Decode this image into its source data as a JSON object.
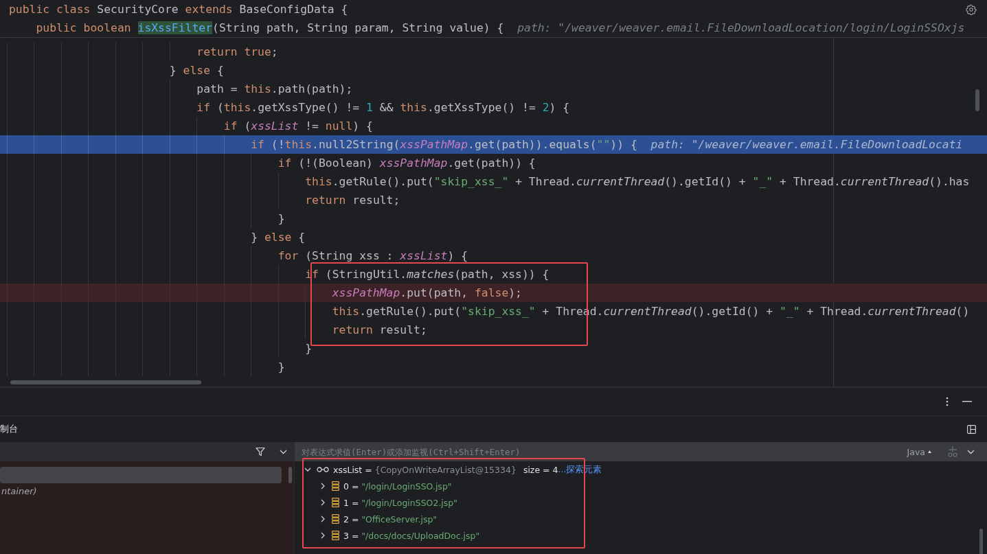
{
  "editor": {
    "sticky_lines": [
      {
        "tokens": [
          {
            "kind": "kw",
            "text": "public"
          },
          {
            "kind": "kw",
            "text": " class"
          },
          {
            "kind": "text",
            "text": " SecurityCore "
          },
          {
            "kind": "kw",
            "text": "extends"
          },
          {
            "kind": "text",
            "text": " BaseConfigData {"
          }
        ]
      },
      {
        "tokens": [
          {
            "kind": "kw",
            "text": "    public"
          },
          {
            "kind": "kw",
            "text": " boolean "
          },
          {
            "kind": "decl",
            "text": "isXssFilter"
          },
          {
            "kind": "text",
            "text": "(String path, String param, String value) {"
          }
        ],
        "hint": "path: \"/weaver/weaver.email.FileDownloadLocation/login/LoginSSOxjs"
      }
    ],
    "lines": [
      {
        "kind": "normal",
        "tokens": [
          {
            "kind": "kw",
            "text": "                            return"
          },
          {
            "kind": "kw",
            "text": " true"
          },
          {
            "kind": "text",
            "text": ";"
          }
        ]
      },
      {
        "kind": "normal",
        "tokens": [
          {
            "kind": "text",
            "text": "                        } "
          },
          {
            "kind": "kw",
            "text": "else"
          },
          {
            "kind": "text",
            "text": " {"
          }
        ]
      },
      {
        "kind": "normal",
        "tokens": [
          {
            "kind": "text",
            "text": "                            path = "
          },
          {
            "kind": "kw",
            "text": "this"
          },
          {
            "kind": "text",
            "text": ".path(path);"
          }
        ]
      },
      {
        "kind": "normal",
        "tokens": [
          {
            "kind": "kw",
            "text": "                            if"
          },
          {
            "kind": "text",
            "text": " ("
          },
          {
            "kind": "kw",
            "text": "this"
          },
          {
            "kind": "text",
            "text": ".getXssType() != "
          },
          {
            "kind": "num",
            "text": "1"
          },
          {
            "kind": "text",
            "text": " && "
          },
          {
            "kind": "kw",
            "text": "this"
          },
          {
            "kind": "text",
            "text": ".getXssType() != "
          },
          {
            "kind": "num",
            "text": "2"
          },
          {
            "kind": "text",
            "text": ") {"
          }
        ]
      },
      {
        "kind": "normal",
        "tokens": [
          {
            "kind": "kw",
            "text": "                                if"
          },
          {
            "kind": "text",
            "text": " ("
          },
          {
            "kind": "field",
            "text": "xssList"
          },
          {
            "kind": "text",
            "text": " != "
          },
          {
            "kind": "kw",
            "text": "null"
          },
          {
            "kind": "text",
            "text": ") {"
          }
        ]
      },
      {
        "kind": "execution",
        "tokens": [
          {
            "kind": "kw",
            "text": "                                    if"
          },
          {
            "kind": "text",
            "text": " (!"
          },
          {
            "kind": "kw",
            "text": "this"
          },
          {
            "kind": "text",
            "text": ".null2String("
          },
          {
            "kind": "field",
            "text": "xssPathMap"
          },
          {
            "kind": "text",
            "text": ".get(path)).equals("
          },
          {
            "kind": "str",
            "text": "\"\""
          },
          {
            "kind": "text",
            "text": ")) {"
          }
        ],
        "hint": "path: \"/weaver/weaver.email.FileDownloadLocati"
      },
      {
        "kind": "normal",
        "tokens": [
          {
            "kind": "kw",
            "text": "                                        if"
          },
          {
            "kind": "text",
            "text": " (!(Boolean) "
          },
          {
            "kind": "field",
            "text": "xssPathMap"
          },
          {
            "kind": "text",
            "text": ".get(path)) {"
          }
        ]
      },
      {
        "kind": "normal",
        "tokens": [
          {
            "kind": "kw",
            "text": "                                            this"
          },
          {
            "kind": "text",
            "text": ".getRule().put("
          },
          {
            "kind": "str",
            "text": "\"skip_xss_\""
          },
          {
            "kind": "text",
            "text": " + Thread."
          },
          {
            "kind": "static",
            "text": "currentThread"
          },
          {
            "kind": "text",
            "text": "().getId() + "
          },
          {
            "kind": "str",
            "text": "\"_\""
          },
          {
            "kind": "text",
            "text": " + Thread."
          },
          {
            "kind": "static",
            "text": "currentThread"
          },
          {
            "kind": "text",
            "text": "().has"
          }
        ]
      },
      {
        "kind": "normal",
        "tokens": [
          {
            "kind": "kw",
            "text": "                                            return"
          },
          {
            "kind": "text",
            "text": " result;"
          }
        ]
      },
      {
        "kind": "normal",
        "tokens": [
          {
            "kind": "text",
            "text": "                                        }"
          }
        ]
      },
      {
        "kind": "normal",
        "tokens": [
          {
            "kind": "text",
            "text": "                                    } "
          },
          {
            "kind": "kw",
            "text": "else"
          },
          {
            "kind": "text",
            "text": " {"
          }
        ]
      },
      {
        "kind": "normal",
        "tokens": [
          {
            "kind": "kw",
            "text": "                                        for"
          },
          {
            "kind": "text",
            "text": " (String xss : "
          },
          {
            "kind": "field",
            "text": "xssList"
          },
          {
            "kind": "text",
            "text": ") {"
          }
        ]
      },
      {
        "kind": "normal",
        "tokens": [
          {
            "kind": "kw",
            "text": "                                            if"
          },
          {
            "kind": "text",
            "text": " (StringUtil."
          },
          {
            "kind": "static",
            "text": "matches"
          },
          {
            "kind": "text",
            "text": "(path, xss)) {"
          }
        ]
      },
      {
        "kind": "breakpoint",
        "tokens": [
          {
            "kind": "field",
            "text": "                                                xssPathMap"
          },
          {
            "kind": "text",
            "text": ".put(path, "
          },
          {
            "kind": "kw",
            "text": "false"
          },
          {
            "kind": "text",
            "text": ");"
          }
        ]
      },
      {
        "kind": "normal",
        "tokens": [
          {
            "kind": "kw",
            "text": "                                                this"
          },
          {
            "kind": "text",
            "text": ".getRule().put("
          },
          {
            "kind": "str",
            "text": "\"skip_xss_\""
          },
          {
            "kind": "text",
            "text": " + Thread."
          },
          {
            "kind": "static",
            "text": "currentThread"
          },
          {
            "kind": "text",
            "text": "().getId() + "
          },
          {
            "kind": "str",
            "text": "\"_\""
          },
          {
            "kind": "text",
            "text": " + Thread."
          },
          {
            "kind": "static",
            "text": "currentThread"
          },
          {
            "kind": "text",
            "text": "()"
          }
        ]
      },
      {
        "kind": "normal",
        "tokens": [
          {
            "kind": "kw",
            "text": "                                                return"
          },
          {
            "kind": "text",
            "text": " result;"
          }
        ]
      },
      {
        "kind": "normal",
        "tokens": [
          {
            "kind": "text",
            "text": "                                            }"
          }
        ]
      },
      {
        "kind": "normal",
        "tokens": [
          {
            "kind": "text",
            "text": "                                        }"
          }
        ]
      }
    ]
  },
  "debugger": {
    "console_tab": {
      "label": "制台"
    },
    "frames": [
      {
        "selected": true
      },
      {
        "selected": false,
        "label": "ntainer)"
      }
    ],
    "evaluate": {
      "placeholder": "对表达式求值(Enter)或添加监视(Ctrl+Shift+Enter)",
      "language": "Java"
    },
    "variables": [
      {
        "name": "xssList",
        "op": "=",
        "value": "{CopyOnWriteArrayList@15334}",
        "size": "size = 4",
        "link": "...探索元素",
        "expanded": true,
        "children": [
          {
            "name": "0",
            "op": "=",
            "value": "\"/login/LoginSSO.jsp\"",
            "expanded": false
          },
          {
            "name": "1",
            "op": "=",
            "value": "\"/login/LoginSSO2.jsp\"",
            "expanded": false
          },
          {
            "name": "2",
            "op": "=",
            "value": "\"OfficeServer.jsp\"",
            "expanded": false
          },
          {
            "name": "3",
            "op": "=",
            "value": "\"/docs/docs/UploadDoc.jsp\"",
            "expanded": false
          }
        ]
      }
    ]
  }
}
